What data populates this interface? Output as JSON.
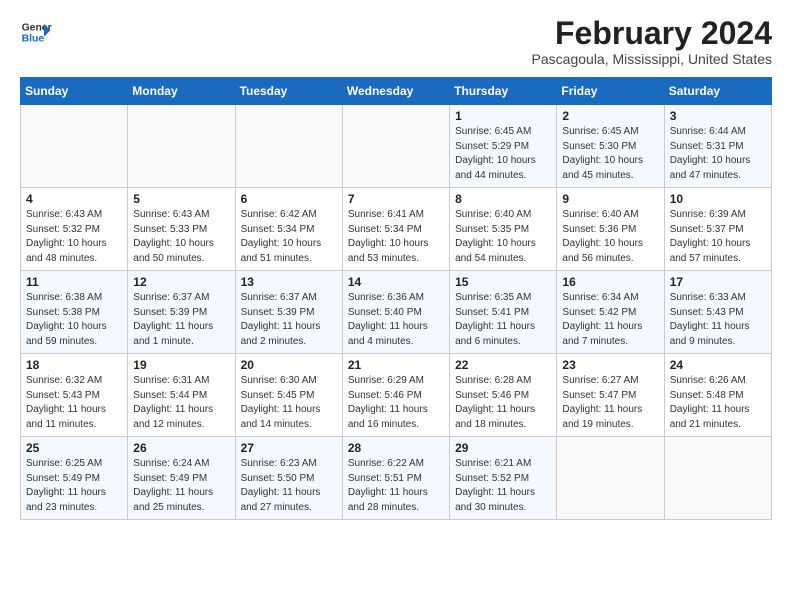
{
  "header": {
    "logo_line1": "General",
    "logo_line2": "Blue",
    "month": "February 2024",
    "location": "Pascagoula, Mississippi, United States"
  },
  "weekdays": [
    "Sunday",
    "Monday",
    "Tuesday",
    "Wednesday",
    "Thursday",
    "Friday",
    "Saturday"
  ],
  "weeks": [
    [
      {
        "day": "",
        "sunrise": "",
        "sunset": "",
        "daylight": ""
      },
      {
        "day": "",
        "sunrise": "",
        "sunset": "",
        "daylight": ""
      },
      {
        "day": "",
        "sunrise": "",
        "sunset": "",
        "daylight": ""
      },
      {
        "day": "",
        "sunrise": "",
        "sunset": "",
        "daylight": ""
      },
      {
        "day": "1",
        "sunrise": "Sunrise: 6:45 AM",
        "sunset": "Sunset: 5:29 PM",
        "daylight": "Daylight: 10 hours and 44 minutes."
      },
      {
        "day": "2",
        "sunrise": "Sunrise: 6:45 AM",
        "sunset": "Sunset: 5:30 PM",
        "daylight": "Daylight: 10 hours and 45 minutes."
      },
      {
        "day": "3",
        "sunrise": "Sunrise: 6:44 AM",
        "sunset": "Sunset: 5:31 PM",
        "daylight": "Daylight: 10 hours and 47 minutes."
      }
    ],
    [
      {
        "day": "4",
        "sunrise": "Sunrise: 6:43 AM",
        "sunset": "Sunset: 5:32 PM",
        "daylight": "Daylight: 10 hours and 48 minutes."
      },
      {
        "day": "5",
        "sunrise": "Sunrise: 6:43 AM",
        "sunset": "Sunset: 5:33 PM",
        "daylight": "Daylight: 10 hours and 50 minutes."
      },
      {
        "day": "6",
        "sunrise": "Sunrise: 6:42 AM",
        "sunset": "Sunset: 5:34 PM",
        "daylight": "Daylight: 10 hours and 51 minutes."
      },
      {
        "day": "7",
        "sunrise": "Sunrise: 6:41 AM",
        "sunset": "Sunset: 5:34 PM",
        "daylight": "Daylight: 10 hours and 53 minutes."
      },
      {
        "day": "8",
        "sunrise": "Sunrise: 6:40 AM",
        "sunset": "Sunset: 5:35 PM",
        "daylight": "Daylight: 10 hours and 54 minutes."
      },
      {
        "day": "9",
        "sunrise": "Sunrise: 6:40 AM",
        "sunset": "Sunset: 5:36 PM",
        "daylight": "Daylight: 10 hours and 56 minutes."
      },
      {
        "day": "10",
        "sunrise": "Sunrise: 6:39 AM",
        "sunset": "Sunset: 5:37 PM",
        "daylight": "Daylight: 10 hours and 57 minutes."
      }
    ],
    [
      {
        "day": "11",
        "sunrise": "Sunrise: 6:38 AM",
        "sunset": "Sunset: 5:38 PM",
        "daylight": "Daylight: 10 hours and 59 minutes."
      },
      {
        "day": "12",
        "sunrise": "Sunrise: 6:37 AM",
        "sunset": "Sunset: 5:39 PM",
        "daylight": "Daylight: 11 hours and 1 minute."
      },
      {
        "day": "13",
        "sunrise": "Sunrise: 6:37 AM",
        "sunset": "Sunset: 5:39 PM",
        "daylight": "Daylight: 11 hours and 2 minutes."
      },
      {
        "day": "14",
        "sunrise": "Sunrise: 6:36 AM",
        "sunset": "Sunset: 5:40 PM",
        "daylight": "Daylight: 11 hours and 4 minutes."
      },
      {
        "day": "15",
        "sunrise": "Sunrise: 6:35 AM",
        "sunset": "Sunset: 5:41 PM",
        "daylight": "Daylight: 11 hours and 6 minutes."
      },
      {
        "day": "16",
        "sunrise": "Sunrise: 6:34 AM",
        "sunset": "Sunset: 5:42 PM",
        "daylight": "Daylight: 11 hours and 7 minutes."
      },
      {
        "day": "17",
        "sunrise": "Sunrise: 6:33 AM",
        "sunset": "Sunset: 5:43 PM",
        "daylight": "Daylight: 11 hours and 9 minutes."
      }
    ],
    [
      {
        "day": "18",
        "sunrise": "Sunrise: 6:32 AM",
        "sunset": "Sunset: 5:43 PM",
        "daylight": "Daylight: 11 hours and 11 minutes."
      },
      {
        "day": "19",
        "sunrise": "Sunrise: 6:31 AM",
        "sunset": "Sunset: 5:44 PM",
        "daylight": "Daylight: 11 hours and 12 minutes."
      },
      {
        "day": "20",
        "sunrise": "Sunrise: 6:30 AM",
        "sunset": "Sunset: 5:45 PM",
        "daylight": "Daylight: 11 hours and 14 minutes."
      },
      {
        "day": "21",
        "sunrise": "Sunrise: 6:29 AM",
        "sunset": "Sunset: 5:46 PM",
        "daylight": "Daylight: 11 hours and 16 minutes."
      },
      {
        "day": "22",
        "sunrise": "Sunrise: 6:28 AM",
        "sunset": "Sunset: 5:46 PM",
        "daylight": "Daylight: 11 hours and 18 minutes."
      },
      {
        "day": "23",
        "sunrise": "Sunrise: 6:27 AM",
        "sunset": "Sunset: 5:47 PM",
        "daylight": "Daylight: 11 hours and 19 minutes."
      },
      {
        "day": "24",
        "sunrise": "Sunrise: 6:26 AM",
        "sunset": "Sunset: 5:48 PM",
        "daylight": "Daylight: 11 hours and 21 minutes."
      }
    ],
    [
      {
        "day": "25",
        "sunrise": "Sunrise: 6:25 AM",
        "sunset": "Sunset: 5:49 PM",
        "daylight": "Daylight: 11 hours and 23 minutes."
      },
      {
        "day": "26",
        "sunrise": "Sunrise: 6:24 AM",
        "sunset": "Sunset: 5:49 PM",
        "daylight": "Daylight: 11 hours and 25 minutes."
      },
      {
        "day": "27",
        "sunrise": "Sunrise: 6:23 AM",
        "sunset": "Sunset: 5:50 PM",
        "daylight": "Daylight: 11 hours and 27 minutes."
      },
      {
        "day": "28",
        "sunrise": "Sunrise: 6:22 AM",
        "sunset": "Sunset: 5:51 PM",
        "daylight": "Daylight: 11 hours and 28 minutes."
      },
      {
        "day": "29",
        "sunrise": "Sunrise: 6:21 AM",
        "sunset": "Sunset: 5:52 PM",
        "daylight": "Daylight: 11 hours and 30 minutes."
      },
      {
        "day": "",
        "sunrise": "",
        "sunset": "",
        "daylight": ""
      },
      {
        "day": "",
        "sunrise": "",
        "sunset": "",
        "daylight": ""
      }
    ]
  ]
}
